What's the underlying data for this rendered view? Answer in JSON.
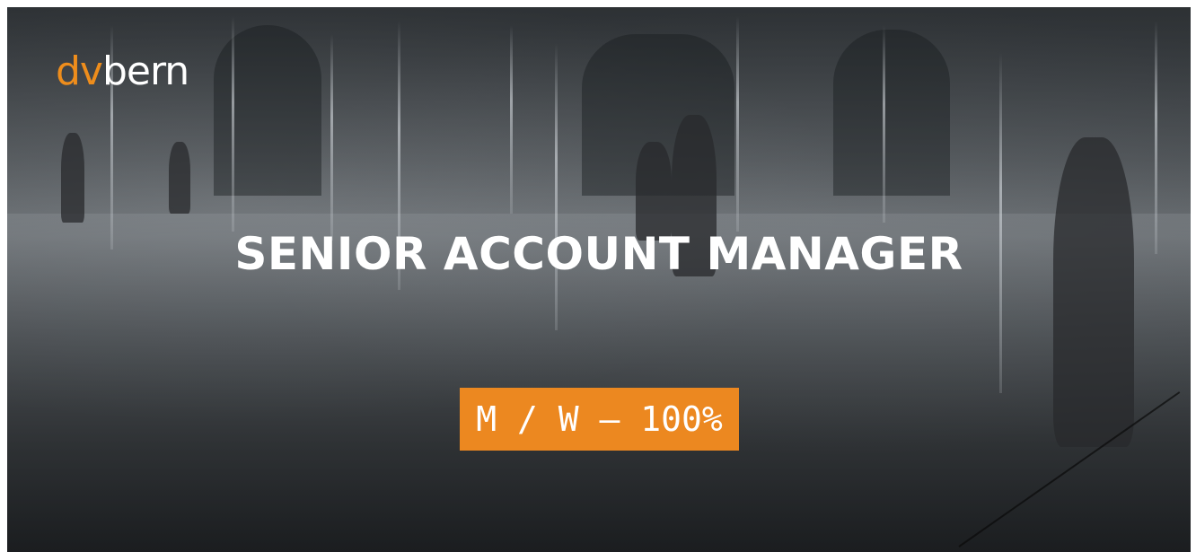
{
  "logo": {
    "part1": "dv",
    "part2": "bern"
  },
  "title": "SENIOR ACCOUNT MANAGER",
  "badge": "M / W – 100%",
  "colors": {
    "accent": "#ec8820",
    "logo_orange": "#ee8d1c",
    "text": "#ffffff"
  },
  "background_image": "grayscale fountain plaza with children playing"
}
